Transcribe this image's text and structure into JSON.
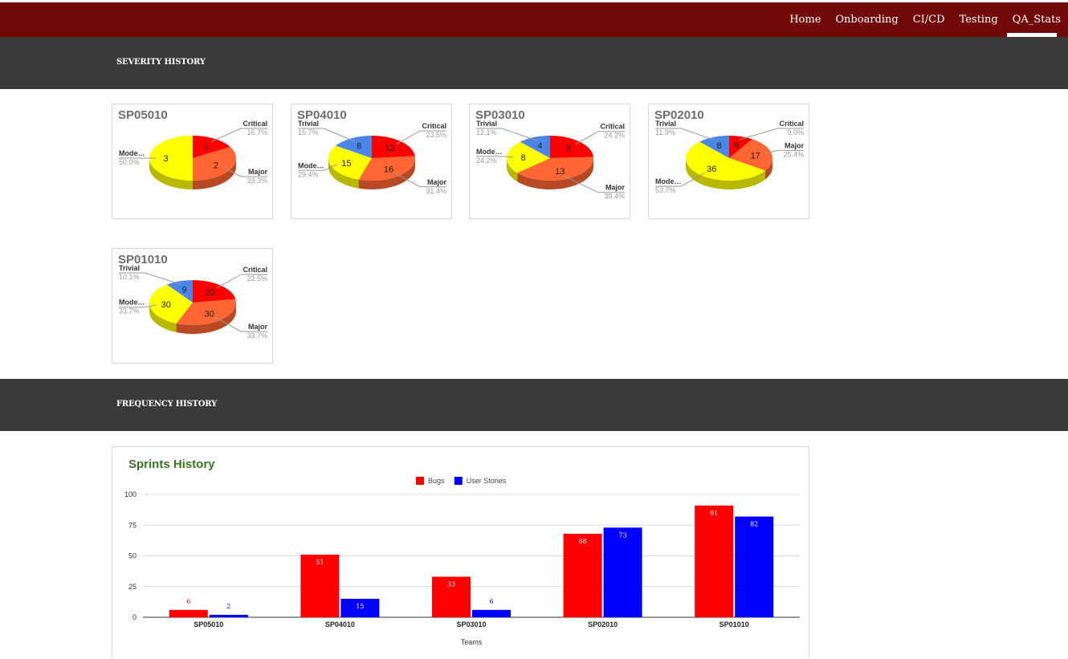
{
  "nav": {
    "items": [
      {
        "label": "Home",
        "active": false
      },
      {
        "label": "Onboarding",
        "active": false
      },
      {
        "label": "CI/CD",
        "active": false
      },
      {
        "label": "Testing",
        "active": false
      },
      {
        "label": "QA_Stats",
        "active": true
      }
    ]
  },
  "sections": {
    "severity_title": "SEVERITY HISTORY",
    "frequency_title": "FREQUENCY HISTORY"
  },
  "colors": {
    "critical": "#ff0000",
    "major": "#ff6633",
    "moderate": "#ffff00",
    "trivial": "#4a86e8",
    "bugs": "#ff0000",
    "user_stories": "#0000ff",
    "title_green": "#38761d"
  },
  "chart_data": [
    {
      "type": "pie",
      "title": "SP05010",
      "slices": [
        {
          "label": "Critical",
          "value": 1,
          "percent": "16.7%",
          "color": "#ff0000"
        },
        {
          "label": "Major",
          "value": 2,
          "percent": "33.3%",
          "color": "#ff6633"
        },
        {
          "label": "Mode…",
          "value": 3,
          "percent": "50.0%",
          "color": "#ffff00"
        }
      ]
    },
    {
      "type": "pie",
      "title": "SP04010",
      "slices": [
        {
          "label": "Critical",
          "value": 12,
          "percent": "23.5%",
          "color": "#ff0000"
        },
        {
          "label": "Major",
          "value": 16,
          "percent": "31.4%",
          "color": "#ff6633"
        },
        {
          "label": "Mode…",
          "value": 15,
          "percent": "29.4%",
          "color": "#ffff00"
        },
        {
          "label": "Trivial",
          "value": 8,
          "percent": "15.7%",
          "color": "#4a86e8"
        }
      ]
    },
    {
      "type": "pie",
      "title": "SP03010",
      "slices": [
        {
          "label": "Critical",
          "value": 8,
          "percent": "24.2%",
          "color": "#ff0000"
        },
        {
          "label": "Major",
          "value": 13,
          "percent": "39.4%",
          "color": "#ff6633"
        },
        {
          "label": "Mode…",
          "value": 8,
          "percent": "24.2%",
          "color": "#ffff00"
        },
        {
          "label": "Trivial",
          "value": 4,
          "percent": "12.1%",
          "color": "#4a86e8"
        }
      ]
    },
    {
      "type": "pie",
      "title": "SP02010",
      "slices": [
        {
          "label": "Critical",
          "value": 6,
          "percent": "9.0%",
          "color": "#ff0000"
        },
        {
          "label": "Major",
          "value": 17,
          "percent": "25.4%",
          "color": "#ff6633"
        },
        {
          "label": "Mode…",
          "value": 36,
          "percent": "53.7%",
          "color": "#ffff00"
        },
        {
          "label": "Trivial",
          "value": 8,
          "percent": "11.9%",
          "color": "#4a86e8"
        }
      ]
    },
    {
      "type": "pie",
      "title": "SP01010",
      "slices": [
        {
          "label": "Critical",
          "value": 20,
          "percent": "22.5%",
          "color": "#ff0000"
        },
        {
          "label": "Major",
          "value": 30,
          "percent": "33.7%",
          "color": "#ff6633"
        },
        {
          "label": "Mode…",
          "value": 30,
          "percent": "33.7%",
          "color": "#ffff00"
        },
        {
          "label": "Trivial",
          "value": 9,
          "percent": "10.1%",
          "color": "#4a86e8"
        }
      ]
    },
    {
      "type": "bar",
      "title": "Sprints History",
      "categories": [
        "SP05010",
        "SP04010",
        "SP03010",
        "SP02010",
        "SP01010"
      ],
      "series": [
        {
          "name": "Bugs",
          "values": [
            6,
            51,
            33,
            68,
            91
          ],
          "color": "#ff0000"
        },
        {
          "name": "User Stories",
          "values": [
            2,
            15,
            6,
            73,
            82
          ],
          "color": "#0000ff"
        }
      ],
      "xlabel": "Teams",
      "ylabel": "",
      "ylim": [
        0,
        100
      ],
      "yticks": [
        0,
        25,
        50,
        75,
        100
      ],
      "grid": true,
      "legend": "top"
    }
  ]
}
